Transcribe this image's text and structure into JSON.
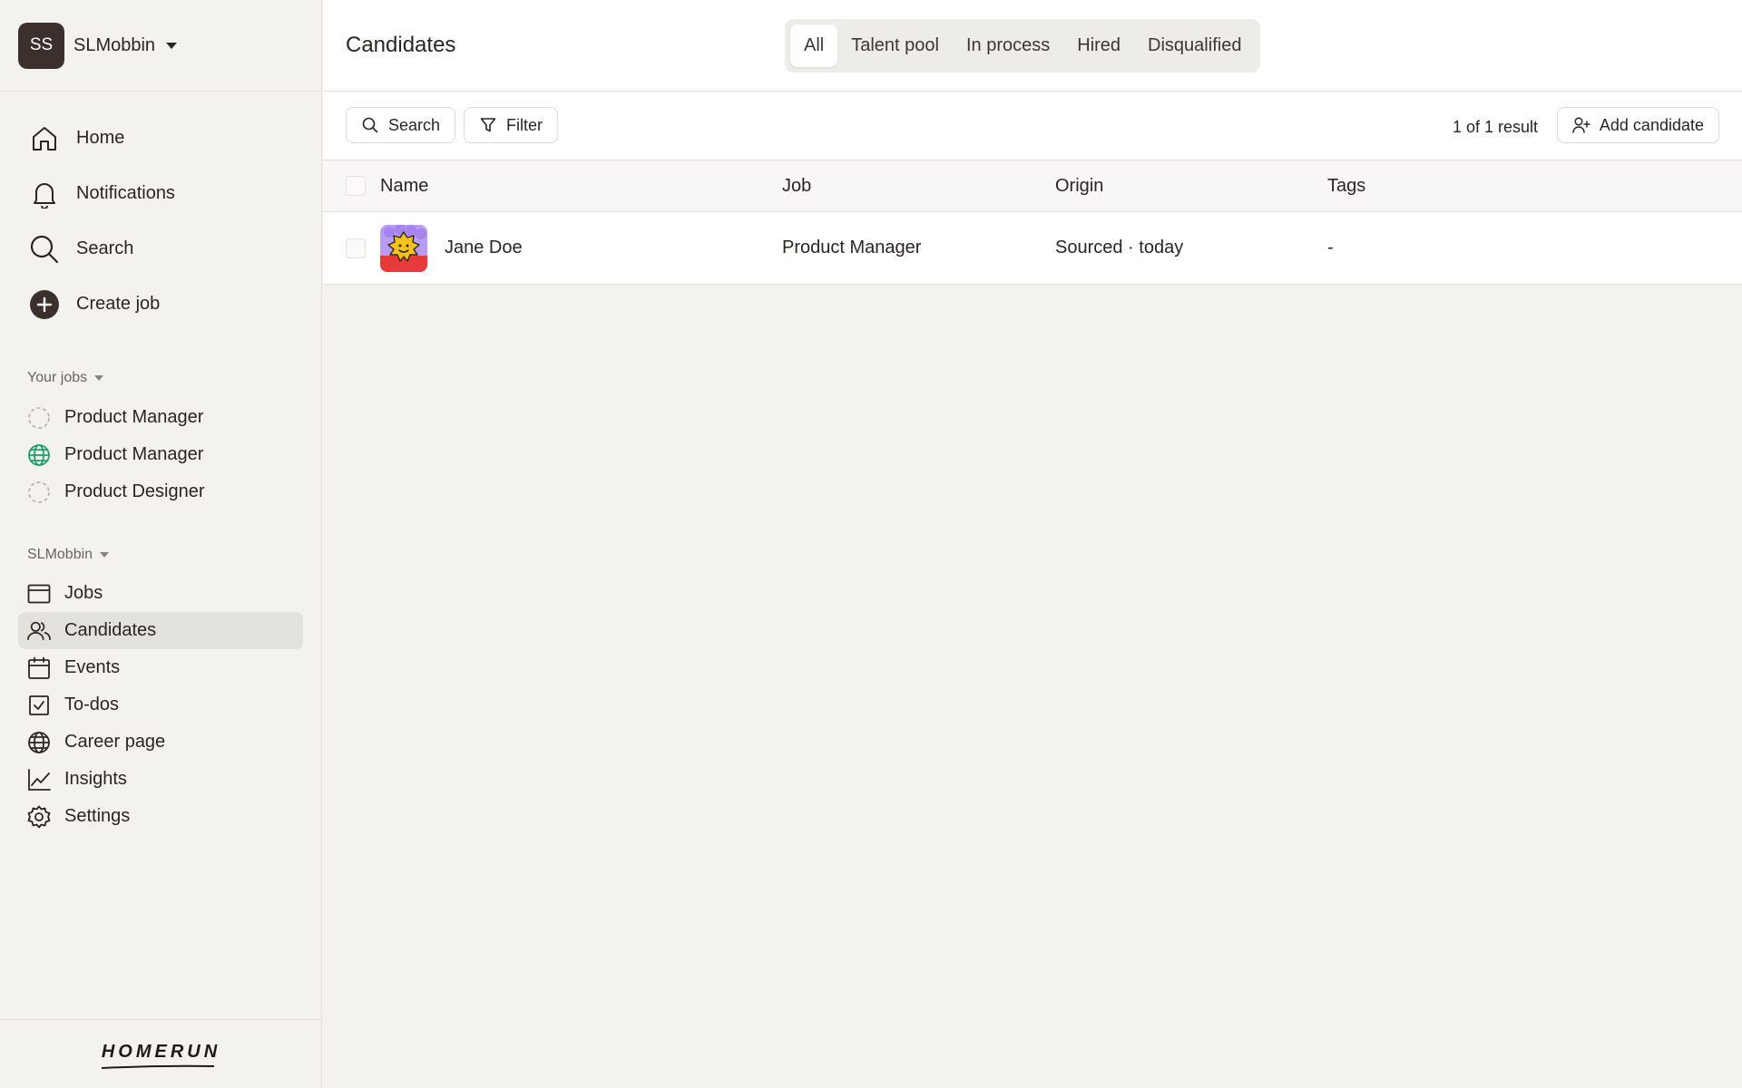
{
  "workspace": {
    "initials": "SS",
    "name": "SLMobbin"
  },
  "main_nav": [
    {
      "label": "Home",
      "icon": "home-icon"
    },
    {
      "label": "Notifications",
      "icon": "bell-icon"
    },
    {
      "label": "Search",
      "icon": "search-icon"
    },
    {
      "label": "Create job",
      "icon": "plus-circle-icon"
    }
  ],
  "your_jobs": {
    "title": "Your jobs",
    "items": [
      {
        "label": "Product Manager",
        "icon": "dashed-circle-icon"
      },
      {
        "label": "Product Manager",
        "icon": "globe-icon"
      },
      {
        "label": "Product Designer",
        "icon": "dashed-circle-icon"
      }
    ]
  },
  "org": {
    "title": "SLMobbin",
    "items": [
      {
        "label": "Jobs",
        "icon": "window-icon"
      },
      {
        "label": "Candidates",
        "icon": "users-icon",
        "active": true
      },
      {
        "label": "Events",
        "icon": "calendar-icon"
      },
      {
        "label": "To-dos",
        "icon": "checkbox-icon"
      },
      {
        "label": "Career page",
        "icon": "globe-icon"
      },
      {
        "label": "Insights",
        "icon": "chart-line-icon"
      },
      {
        "label": "Settings",
        "icon": "gear-icon"
      }
    ]
  },
  "footer": {
    "logo": "HOMERUN"
  },
  "header": {
    "title": "Candidates",
    "tabs": [
      {
        "label": "All",
        "active": true
      },
      {
        "label": "Talent pool"
      },
      {
        "label": "In process"
      },
      {
        "label": "Hired"
      },
      {
        "label": "Disqualified"
      }
    ]
  },
  "toolbar": {
    "search_label": "Search",
    "filter_label": "Filter",
    "result_count": "1 of 1 result",
    "add_label": "Add candidate"
  },
  "table": {
    "columns": [
      "Name",
      "Job",
      "Origin",
      "Tags"
    ],
    "rows": [
      {
        "name": "Jane Doe",
        "job": "Product Manager",
        "origin": "Sourced · today",
        "tags": "-"
      }
    ]
  },
  "colors": {
    "accent_globe": "#1f9e6e",
    "sidebar_active": "#e3e1dc",
    "avatar_bg": "#3b302c"
  }
}
